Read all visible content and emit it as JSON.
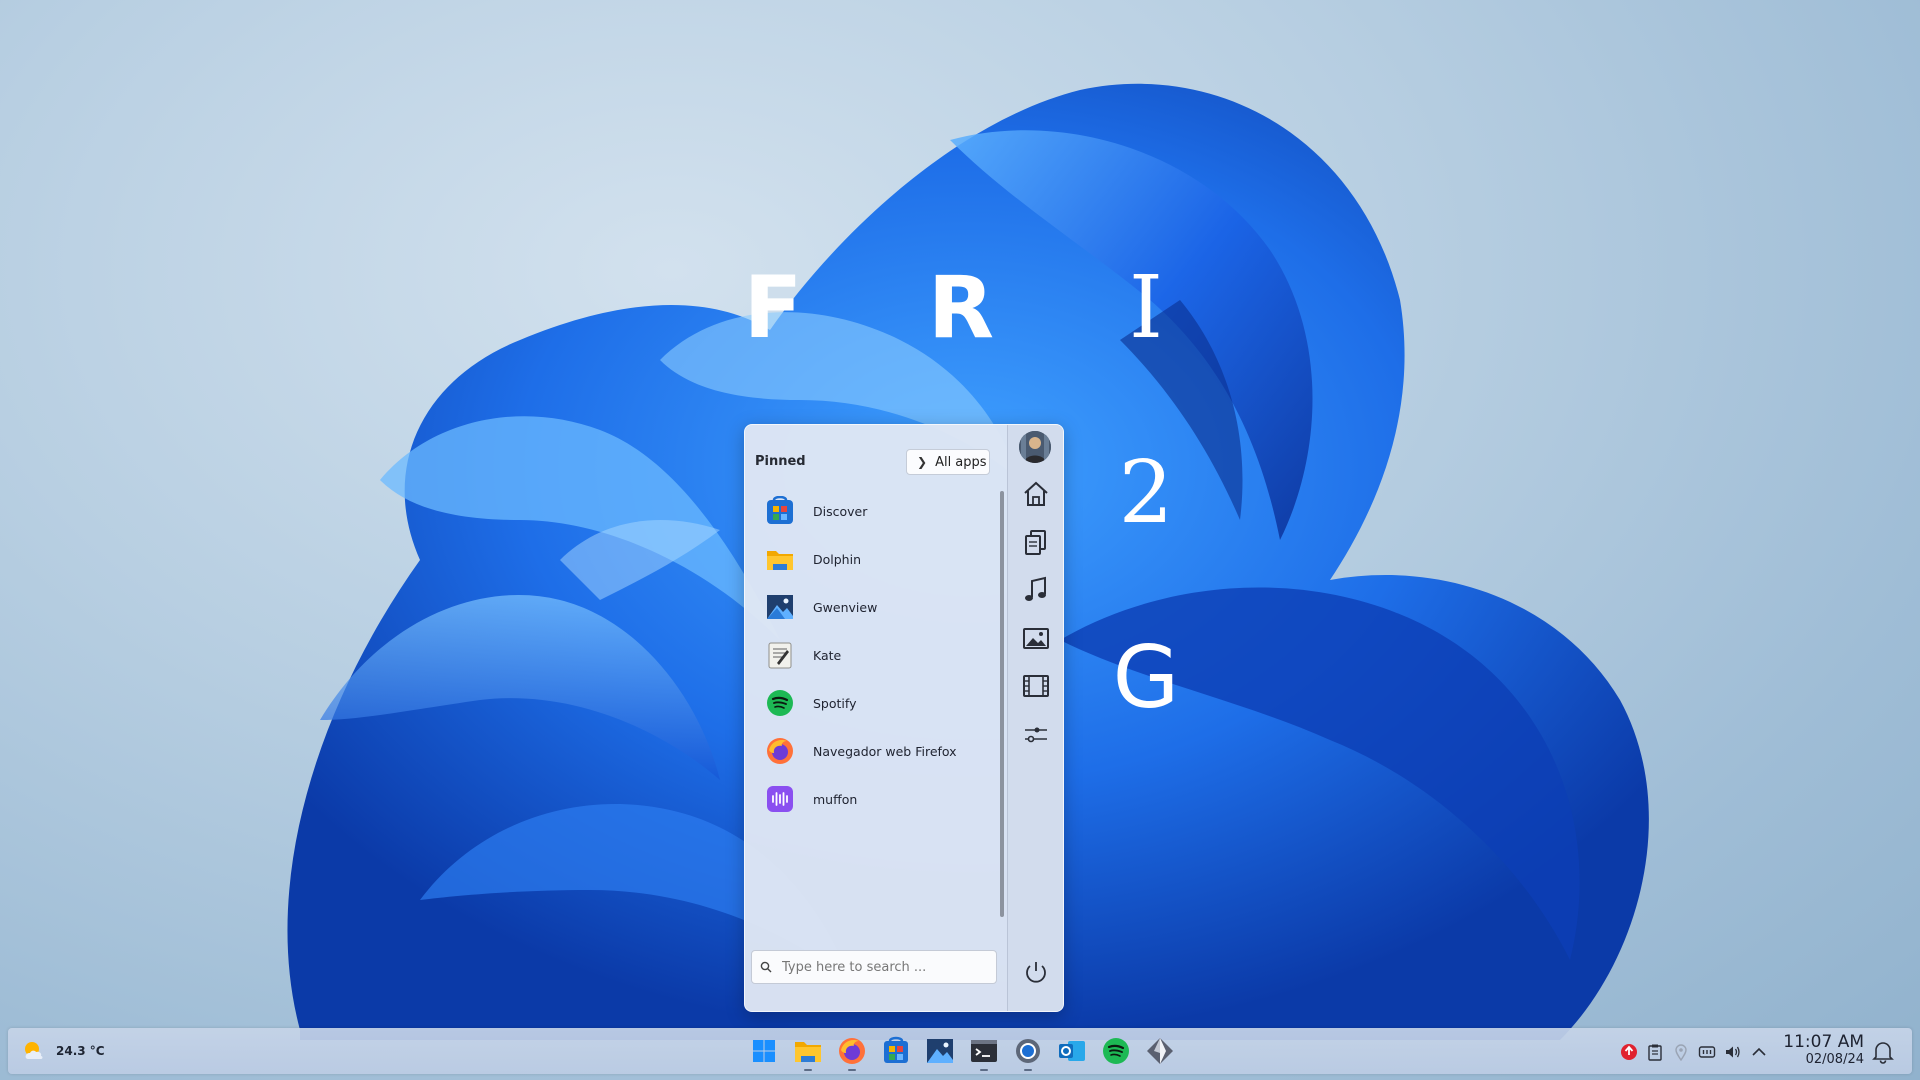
{
  "desktop": {
    "overlay_letters": [
      "F",
      "R",
      "I",
      "2",
      "G"
    ]
  },
  "start_menu": {
    "pinned_title": "Pinned",
    "all_apps_label": "All apps",
    "apps": [
      {
        "label": "Discover",
        "icon": "discover-icon"
      },
      {
        "label": "Dolphin",
        "icon": "folder-icon"
      },
      {
        "label": "Gwenview",
        "icon": "image-viewer-icon"
      },
      {
        "label": "Kate",
        "icon": "text-editor-icon"
      },
      {
        "label": "Spotify",
        "icon": "spotify-icon"
      },
      {
        "label": "Navegador web Firefox",
        "icon": "firefox-icon"
      },
      {
        "label": "muffon",
        "icon": "muffon-icon"
      }
    ],
    "search_placeholder": "Type here to search ...",
    "rail": [
      "avatar",
      "home-icon",
      "documents-icon",
      "music-icon",
      "pictures-icon",
      "videos-icon",
      "settings-icon",
      "power-icon"
    ]
  },
  "taskbar": {
    "weather_temp": "24.3 °C",
    "pinned_icons": [
      "start-icon",
      "file-manager-icon",
      "firefox-icon",
      "discover-icon",
      "gwenview-icon",
      "terminal-icon",
      "settings-icon",
      "outlook-icon",
      "spotify-icon",
      "app-icon"
    ],
    "tray_icons": [
      "update-alert-icon",
      "clipboard-icon",
      "location-icon",
      "battery-icon",
      "volume-icon",
      "tray-expand-icon"
    ],
    "clock_time": "11:07 AM",
    "clock_date": "02/08/24",
    "notification_icon": "bell-icon"
  },
  "colors": {
    "accent": "#1e5bd8",
    "menu_bg": "#e0e7f4",
    "taskbar_bg": "#c4d4ea"
  }
}
